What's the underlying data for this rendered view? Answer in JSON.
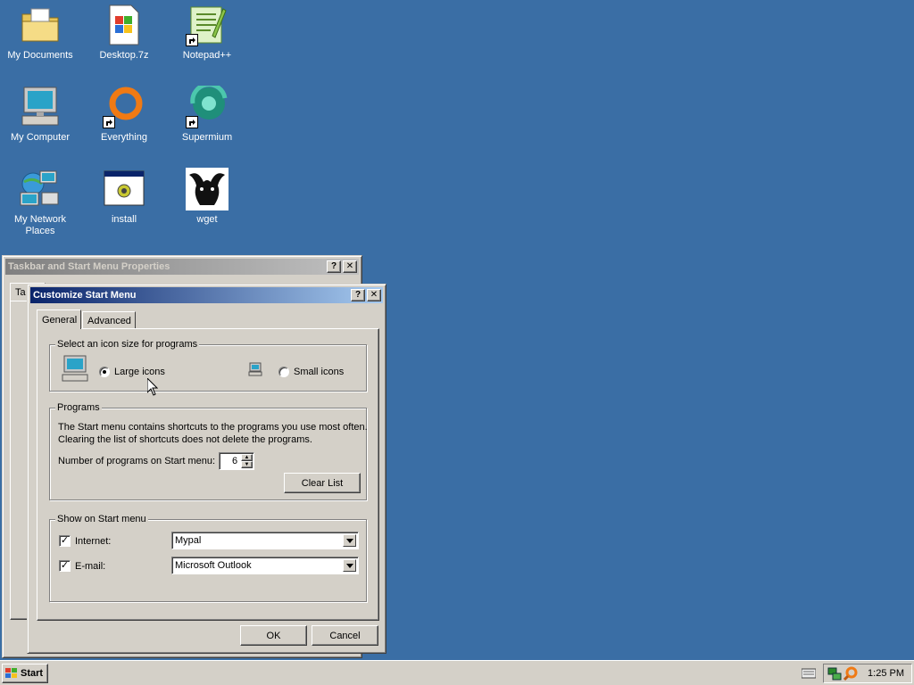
{
  "desktop": {
    "background_color": "#3a6ea5",
    "icons": [
      {
        "label": "My Documents",
        "icon": "folder-icon"
      },
      {
        "label": "Desktop.7z",
        "icon": "archive-file-icon"
      },
      {
        "label": "Notepad++",
        "icon": "notepad-plus-plus-icon"
      },
      {
        "label": "My Computer",
        "icon": "computer-icon"
      },
      {
        "label": "Everything",
        "icon": "everything-search-icon"
      },
      {
        "label": "Supermium",
        "icon": "supermium-browser-icon"
      },
      {
        "label": "My Network Places",
        "icon": "network-places-icon"
      },
      {
        "label": "install",
        "icon": "installer-icon"
      },
      {
        "label": "wget",
        "icon": "wget-icon"
      }
    ]
  },
  "taskbar_props_window": {
    "title": "Taskbar and Start Menu Properties",
    "tab_visible_text": "Ta",
    "help_button": "?",
    "close_button": "✕"
  },
  "customize_dialog": {
    "title": "Customize Start Menu",
    "help_button": "?",
    "close_button": "✕",
    "tabs": [
      {
        "label": "General",
        "selected": true
      },
      {
        "label": "Advanced",
        "selected": false
      }
    ],
    "icon_size_group": {
      "legend": "Select an icon size for programs",
      "large_label": "Large icons",
      "small_label": "Small icons",
      "selected": "large"
    },
    "programs_group": {
      "legend": "Programs",
      "description_line1": "The Start menu contains shortcuts to the programs you use most often.",
      "description_line2": "Clearing the list of shortcuts does not delete the programs.",
      "count_label": "Number of programs on Start menu:",
      "count_value": "6",
      "clear_button": "Clear List"
    },
    "show_group": {
      "legend": "Show on Start menu",
      "internet_label": "Internet:",
      "internet_checked": true,
      "internet_value": "Mypal",
      "email_label": "E-mail:",
      "email_checked": true,
      "email_value": "Microsoft Outlook",
      "check_mark": "✓"
    },
    "ok_button": "OK",
    "cancel_button": "Cancel"
  },
  "taskbar": {
    "start_label": "Start",
    "clock": "1:25 PM"
  }
}
